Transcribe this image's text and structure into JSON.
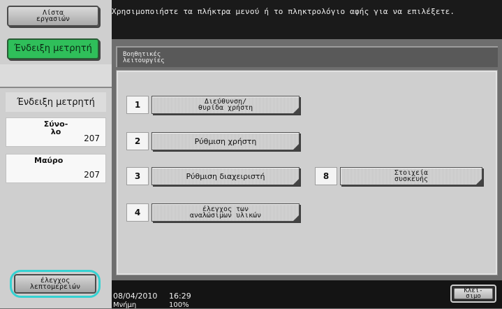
{
  "sidebar": {
    "job_list_label": "Λίστα\nεργασιών",
    "counter_button_label": "Ένδειξη μετρητή",
    "counter_title": "Ένδειξη μετρητή",
    "total": {
      "label": "Σύνο-\nλο",
      "value": "207"
    },
    "black": {
      "label": "Μαύρο",
      "value": "207"
    },
    "detail_check_label": "έλεγχος\nλεπτομερειών"
  },
  "message": "Χρησιμοποιήστε τα πλήκτρα μενού ή το πληκτρολόγιο αφής για να επιλέξετε.",
  "panel": {
    "title": "Βοηθητικές\nλειτουργίες",
    "functions": [
      {
        "number": "1",
        "label": "Διεύθυνση/\nθυρίδα χρήστη"
      },
      {
        "number": "2",
        "label": "Ρύθμιση χρήστη"
      },
      {
        "number": "3",
        "label": "Ρύθμιση διαχειριστή"
      },
      {
        "number": "8",
        "label": "Στοιχεία\nσυσκευής"
      },
      {
        "number": "4",
        "label": "έλεγχος των\nαναλώσιμων υλικών"
      }
    ]
  },
  "status": {
    "date": "08/04/2010",
    "time": "16:29",
    "memory_label": "Μνήμη",
    "memory_value": "100%"
  },
  "close_label": "Κλεί-\nσιμο"
}
